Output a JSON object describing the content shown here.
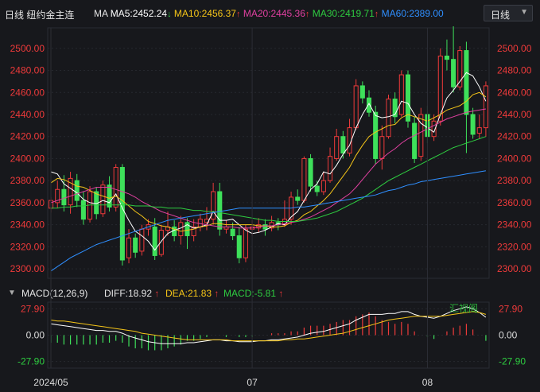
{
  "header": {
    "title": "日线 纽约金主连",
    "ma_label": "MA",
    "ma5": "MA5:2452.24",
    "ma10": "MA10:2456.37",
    "ma20": "MA20:2445.36",
    "ma30": "MA30:2419.71",
    "ma60": "MA60:2389.00",
    "ma5_arrow": "↓",
    "ma10_arrow": "↑",
    "ma20_arrow": "↑",
    "ma30_arrow": "↑",
    "ma60_arrow": "↑",
    "colors": {
      "ma5": "#ffffff",
      "ma10": "#f5c518",
      "ma20": "#e040a0",
      "ma30": "#2ecc40",
      "ma60": "#2f8fff"
    }
  },
  "period_select": {
    "selected": "日线"
  },
  "price_axis": {
    "ticks": [
      "2500.00",
      "2480.00",
      "2460.00",
      "2440.00",
      "2420.00",
      "2400.00",
      "2380.00",
      "2360.00",
      "2340.00",
      "2320.00",
      "2300.00"
    ]
  },
  "macd": {
    "label": "MACD(12,26,9)",
    "diff": "DIFF:18.92",
    "dea": "DEA:21.83",
    "macd": "MACD:-5.81",
    "diff_arrow": "↑",
    "dea_arrow": "↑",
    "macd_arrow": "↑",
    "ticks": [
      "27.90",
      "0.00",
      "-27.90"
    ]
  },
  "x_axis": {
    "labels": [
      "2024/05",
      "07",
      "08"
    ]
  },
  "watermark": "汇视阁",
  "chart_data": {
    "type": "candlestick",
    "title": "日线 纽约金主连",
    "ylim": [
      2295,
      2515
    ],
    "macd_ylim": [
      -35,
      35
    ],
    "candles": [
      [
        2355,
        2362,
        2351,
        2365
      ],
      [
        2360,
        2372,
        2355,
        2380
      ],
      [
        2372,
        2358,
        2352,
        2385
      ],
      [
        2358,
        2382,
        2350,
        2388
      ],
      [
        2380,
        2362,
        2356,
        2386
      ],
      [
        2362,
        2345,
        2340,
        2370
      ],
      [
        2345,
        2370,
        2342,
        2375
      ],
      [
        2370,
        2350,
        2345,
        2374
      ],
      [
        2350,
        2376,
        2347,
        2380
      ],
      [
        2376,
        2356,
        2352,
        2384
      ],
      [
        2356,
        2392,
        2352,
        2395
      ],
      [
        2392,
        2308,
        2303,
        2395
      ],
      [
        2310,
        2328,
        2305,
        2336
      ],
      [
        2328,
        2315,
        2310,
        2332
      ],
      [
        2316,
        2336,
        2312,
        2340
      ],
      [
        2336,
        2340,
        2330,
        2345
      ],
      [
        2338,
        2312,
        2308,
        2346
      ],
      [
        2313,
        2335,
        2311,
        2340
      ],
      [
        2335,
        2338,
        2330,
        2352
      ],
      [
        2338,
        2330,
        2325,
        2344
      ],
      [
        2330,
        2342,
        2322,
        2348
      ],
      [
        2342,
        2330,
        2318,
        2346
      ],
      [
        2330,
        2338,
        2325,
        2345
      ],
      [
        2338,
        2345,
        2334,
        2350
      ],
      [
        2342,
        2345,
        2335,
        2356
      ],
      [
        2345,
        2370,
        2340,
        2378
      ],
      [
        2370,
        2336,
        2330,
        2378
      ],
      [
        2336,
        2338,
        2332,
        2344
      ],
      [
        2336,
        2330,
        2326,
        2342
      ],
      [
        2330,
        2310,
        2305,
        2338
      ],
      [
        2310,
        2336,
        2306,
        2340
      ],
      [
        2336,
        2338,
        2330,
        2344
      ],
      [
        2337,
        2340,
        2333,
        2346
      ],
      [
        2340,
        2336,
        2330,
        2345
      ],
      [
        2337,
        2342,
        2334,
        2348
      ],
      [
        2342,
        2340,
        2335,
        2346
      ],
      [
        2340,
        2345,
        2338,
        2362
      ],
      [
        2345,
        2365,
        2340,
        2370
      ],
      [
        2365,
        2362,
        2358,
        2372
      ],
      [
        2362,
        2400,
        2360,
        2402
      ],
      [
        2400,
        2375,
        2370,
        2404
      ],
      [
        2375,
        2370,
        2366,
        2380
      ],
      [
        2370,
        2380,
        2367,
        2388
      ],
      [
        2380,
        2402,
        2378,
        2410
      ],
      [
        2400,
        2420,
        2398,
        2427
      ],
      [
        2420,
        2405,
        2400,
        2425
      ],
      [
        2405,
        2428,
        2402,
        2436
      ],
      [
        2428,
        2466,
        2426,
        2472
      ],
      [
        2466,
        2455,
        2450,
        2470
      ],
      [
        2455,
        2442,
        2438,
        2462
      ],
      [
        2442,
        2400,
        2395,
        2448
      ],
      [
        2400,
        2420,
        2390,
        2430
      ],
      [
        2420,
        2454,
        2418,
        2458
      ],
      [
        2454,
        2438,
        2432,
        2460
      ],
      [
        2440,
        2476,
        2438,
        2480
      ],
      [
        2476,
        2434,
        2428,
        2480
      ],
      [
        2432,
        2400,
        2396,
        2438
      ],
      [
        2402,
        2440,
        2398,
        2446
      ],
      [
        2440,
        2420,
        2414,
        2448
      ],
      [
        2420,
        2434,
        2416,
        2440
      ],
      [
        2434,
        2493,
        2430,
        2500
      ],
      [
        2493,
        2490,
        2480,
        2508
      ],
      [
        2490,
        2465,
        2460,
        2520
      ],
      [
        2465,
        2498,
        2462,
        2502
      ],
      [
        2498,
        2440,
        2405,
        2506
      ],
      [
        2440,
        2422,
        2418,
        2446
      ],
      [
        2423,
        2428,
        2418,
        2440
      ],
      [
        2428,
        2466,
        2420,
        2470
      ]
    ],
    "series": [
      {
        "name": "MA5",
        "values": [
          2388,
          2386,
          2377,
          2373,
          2369,
          2363,
          2360,
          2359,
          2362,
          2360,
          2368,
          2355,
          2344,
          2334,
          2330,
          2325,
          2317,
          2325,
          2332,
          2335,
          2337,
          2340,
          2337,
          2338,
          2340,
          2352,
          2344,
          2344,
          2345,
          2340,
          2335,
          2332,
          2333,
          2335,
          2338,
          2341,
          2340,
          2347,
          2352,
          2362,
          2372,
          2377,
          2388,
          2386,
          2394,
          2404,
          2412,
          2428,
          2440,
          2450,
          2439,
          2437,
          2438,
          2440,
          2452,
          2450,
          2440,
          2432,
          2428,
          2424,
          2440,
          2455,
          2462,
          2470,
          2478,
          2475,
          2465,
          2452
        ]
      },
      {
        "name": "MA10",
        "values": [
          2378,
          2382,
          2381,
          2378,
          2375,
          2374,
          2371,
          2368,
          2366,
          2364,
          2366,
          2362,
          2357,
          2352,
          2348,
          2343,
          2341,
          2339,
          2338,
          2336,
          2334,
          2335,
          2336,
          2338,
          2339,
          2341,
          2341,
          2340,
          2340,
          2340,
          2340,
          2340,
          2339,
          2339,
          2338,
          2338,
          2339,
          2342,
          2344,
          2349,
          2352,
          2357,
          2362,
          2368,
          2376,
          2384,
          2392,
          2403,
          2412,
          2420,
          2424,
          2427,
          2430,
          2431,
          2437,
          2440,
          2438,
          2436,
          2434,
          2437,
          2440,
          2444,
          2446,
          2448,
          2452,
          2458,
          2460,
          2456
        ]
      },
      {
        "name": "MA20",
        "values": [
          2360,
          2362,
          2364,
          2366,
          2368,
          2370,
          2372,
          2374,
          2374,
          2374,
          2372,
          2370,
          2368,
          2365,
          2361,
          2358,
          2355,
          2352,
          2350,
          2348,
          2346,
          2344,
          2342,
          2341,
          2340,
          2339,
          2338,
          2338,
          2338,
          2337,
          2337,
          2337,
          2338,
          2339,
          2339,
          2340,
          2341,
          2342,
          2343,
          2345,
          2347,
          2350,
          2353,
          2356,
          2360,
          2364,
          2368,
          2374,
          2381,
          2388,
          2395,
          2400,
          2405,
          2409,
          2414,
          2418,
          2421,
          2424,
          2427,
          2430,
          2433,
          2436,
          2438,
          2440,
          2442,
          2443,
          2444,
          2445
        ]
      },
      {
        "name": "MA30",
        "values": [
          2355,
          2355,
          2356,
          2356,
          2357,
          2357,
          2358,
          2358,
          2358,
          2358,
          2358,
          2358,
          2358,
          2357,
          2357,
          2357,
          2356,
          2356,
          2355,
          2355,
          2355,
          2354,
          2353,
          2353,
          2352,
          2352,
          2351,
          2350,
          2349,
          2348,
          2347,
          2346,
          2345,
          2344,
          2344,
          2343,
          2343,
          2343,
          2343,
          2344,
          2345,
          2346,
          2348,
          2350,
          2352,
          2355,
          2358,
          2361,
          2364,
          2368,
          2372,
          2376,
          2380,
          2383,
          2386,
          2389,
          2392,
          2395,
          2398,
          2401,
          2404,
          2407,
          2410,
          2412,
          2414,
          2416,
          2418,
          2420
        ]
      },
      {
        "name": "MA60",
        "values": [
          2298,
          2302,
          2306,
          2310,
          2313,
          2316,
          2319,
          2322,
          2324,
          2326,
          2328,
          2330,
          2332,
          2334,
          2336,
          2338,
          2340,
          2342,
          2344,
          2345,
          2346,
          2347,
          2348,
          2349,
          2350,
          2351,
          2352,
          2353,
          2354,
          2355,
          2355,
          2355,
          2355,
          2355,
          2355,
          2355,
          2355,
          2355,
          2356,
          2356,
          2357,
          2358,
          2359,
          2360,
          2361,
          2362,
          2363,
          2364,
          2365,
          2366,
          2367,
          2369,
          2371,
          2372,
          2374,
          2376,
          2377,
          2379,
          2380,
          2381,
          2382,
          2383,
          2384,
          2385,
          2386,
          2387,
          2388,
          2389
        ]
      }
    ],
    "macd_diff": [
      12,
      11,
      10,
      9,
      8,
      7,
      6,
      5,
      5,
      4,
      4,
      2,
      -1,
      -3,
      -5,
      -7,
      -8,
      -9,
      -9,
      -9,
      -9,
      -8,
      -8,
      -7,
      -6,
      -5,
      -5,
      -6,
      -6,
      -7,
      -7,
      -7,
      -6,
      -6,
      -5,
      -5,
      -4,
      -3,
      -2,
      0,
      2,
      3,
      4,
      6,
      8,
      10,
      12,
      16,
      19,
      22,
      22,
      22,
      23,
      23,
      25,
      25,
      22,
      20,
      19,
      18,
      20,
      23,
      26,
      28,
      30,
      28,
      24,
      19
    ],
    "macd_dea": [
      16,
      15,
      15,
      14,
      13,
      12,
      11,
      10,
      9,
      8,
      7,
      6,
      5,
      4,
      2,
      1,
      0,
      -1,
      -2,
      -3,
      -4,
      -5,
      -5,
      -5,
      -5,
      -5,
      -5,
      -5,
      -6,
      -6,
      -6,
      -6,
      -6,
      -6,
      -6,
      -6,
      -5,
      -5,
      -4,
      -4,
      -3,
      -2,
      -1,
      0,
      1,
      2,
      4,
      6,
      8,
      10,
      12,
      14,
      16,
      17,
      18,
      19,
      20,
      20,
      20,
      20,
      20,
      21,
      22,
      23,
      24,
      25,
      24,
      22
    ],
    "macd_hist": [
      -8,
      -8,
      -10,
      -10,
      -10,
      -10,
      -10,
      -10,
      -8,
      -8,
      -6,
      -8,
      -12,
      -14,
      -14,
      -16,
      -16,
      -16,
      -14,
      -12,
      -10,
      -6,
      -6,
      -4,
      -2,
      0,
      0,
      -2,
      0,
      -2,
      -2,
      -2,
      0,
      0,
      2,
      2,
      2,
      4,
      4,
      8,
      10,
      10,
      10,
      12,
      14,
      16,
      16,
      20,
      22,
      24,
      20,
      16,
      14,
      12,
      14,
      12,
      4,
      0,
      -2,
      -4,
      0,
      4,
      8,
      10,
      12,
      6,
      0,
      -6
    ]
  }
}
